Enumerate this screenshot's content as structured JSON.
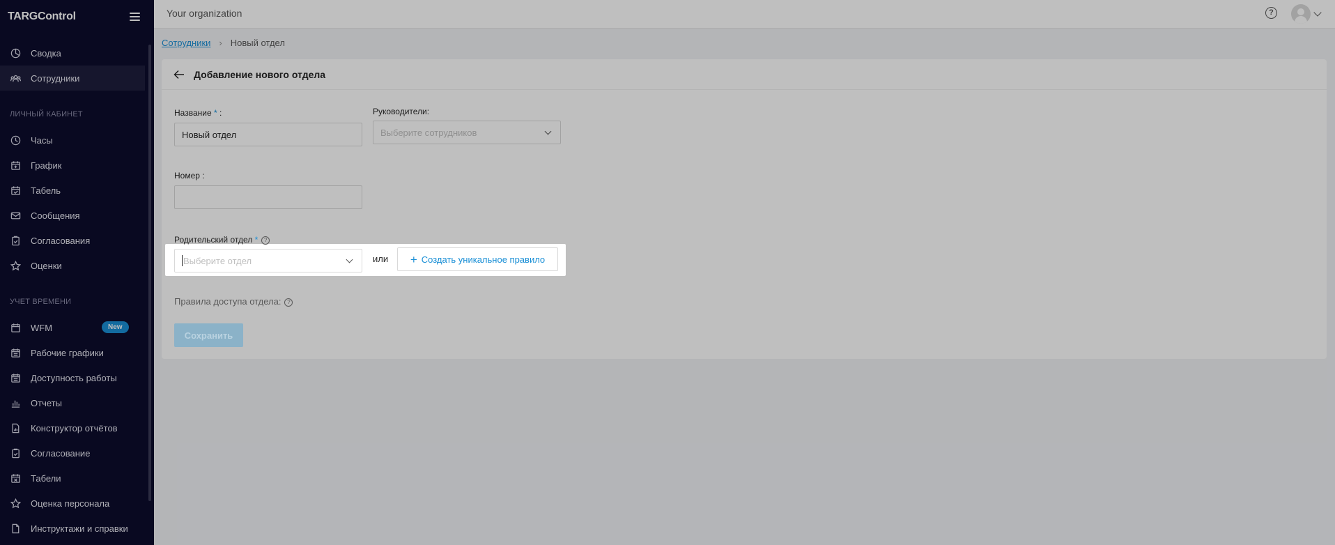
{
  "app": {
    "brand": "TARGControl"
  },
  "sidebar": {
    "items": [
      {
        "label": "Сводка",
        "icon": "dashboard-icon"
      },
      {
        "label": "Сотрудники",
        "icon": "users-icon"
      }
    ],
    "section_personal": "ЛИЧНЫЙ КАБИНЕТ",
    "personal_items": [
      {
        "label": "Часы",
        "icon": "clock-icon"
      },
      {
        "label": "График",
        "icon": "calendar-plus-icon"
      },
      {
        "label": "Табель",
        "icon": "calendar-check-icon"
      },
      {
        "label": "Сообщения",
        "icon": "mail-icon"
      },
      {
        "label": "Согласования",
        "icon": "clipboard-check-icon"
      },
      {
        "label": "Оценки",
        "icon": "star-icon"
      }
    ],
    "section_time": "УЧЕТ ВРЕМЕНИ",
    "time_items": [
      {
        "label": "WFM",
        "icon": "calendar-icon",
        "badge": "New"
      },
      {
        "label": "Рабочие графики",
        "icon": "calendar-grid-icon"
      },
      {
        "label": "Доступность работы",
        "icon": "calendar-grid-icon"
      },
      {
        "label": "Отчеты",
        "icon": "bar-chart-icon"
      },
      {
        "label": "Конструктор отчётов",
        "icon": "file-chart-icon"
      },
      {
        "label": "Согласование",
        "icon": "clipboard-check-icon"
      },
      {
        "label": "Табели",
        "icon": "calendar-x-icon"
      },
      {
        "label": "Оценка персонала",
        "icon": "star-icon"
      },
      {
        "label": "Инструктажи и справки",
        "icon": "document-icon"
      }
    ]
  },
  "header": {
    "org": "Your organization",
    "help": "?"
  },
  "breadcrumb": {
    "parent": "Сотрудники",
    "separator": "›",
    "current": "Новый отдел"
  },
  "form": {
    "title": "Добавление нового отдела",
    "name_label": "Название",
    "required_mark": "*",
    "colon": " :",
    "name_value": "Новый отдел",
    "managers_label": "Руководители:",
    "managers_placeholder": "Выберите сотрудников",
    "number_label": "Номер :",
    "number_value": "",
    "parent_label": "Родительский отдел",
    "parent_placeholder": "Выберите отдел",
    "or": "или",
    "create_rule": "Создать уникальное правило",
    "access_label": "Правила доступа отдела:",
    "save": "Сохранить"
  },
  "colors": {
    "accent": "#1a8fd6",
    "sidebar_bg": "#0c0c2c"
  }
}
